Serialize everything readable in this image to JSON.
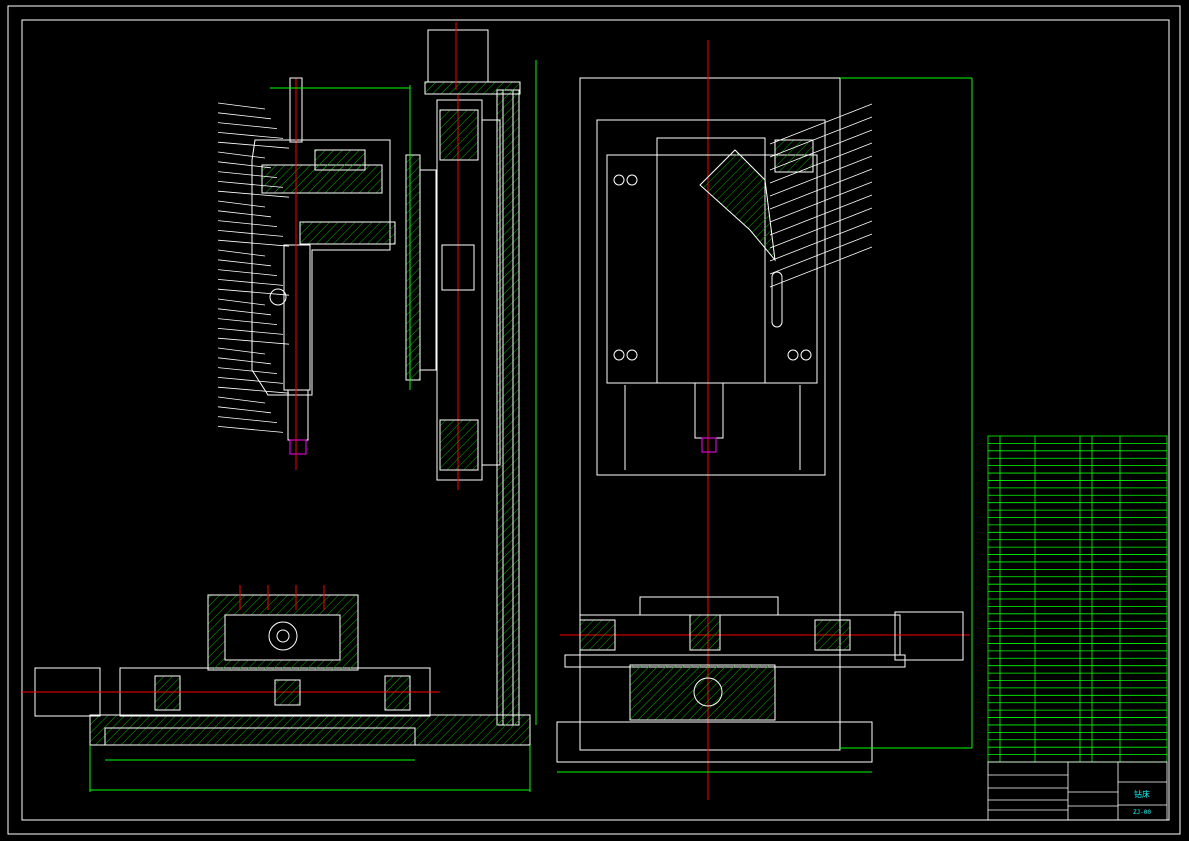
{
  "colors": {
    "background": "#000000",
    "outline": "#ffffff",
    "hatch": "#00c000",
    "dimension": "#00ff00",
    "centerline": "#ff0000",
    "highlight": "#ff00ff",
    "note": "#00ffff"
  },
  "title_block": {
    "drawing_title": "钻床",
    "drawing_number": "ZJ-00"
  },
  "parts_list_rows": 44,
  "balloon_count_left": 34,
  "balloon_count_right": 12
}
